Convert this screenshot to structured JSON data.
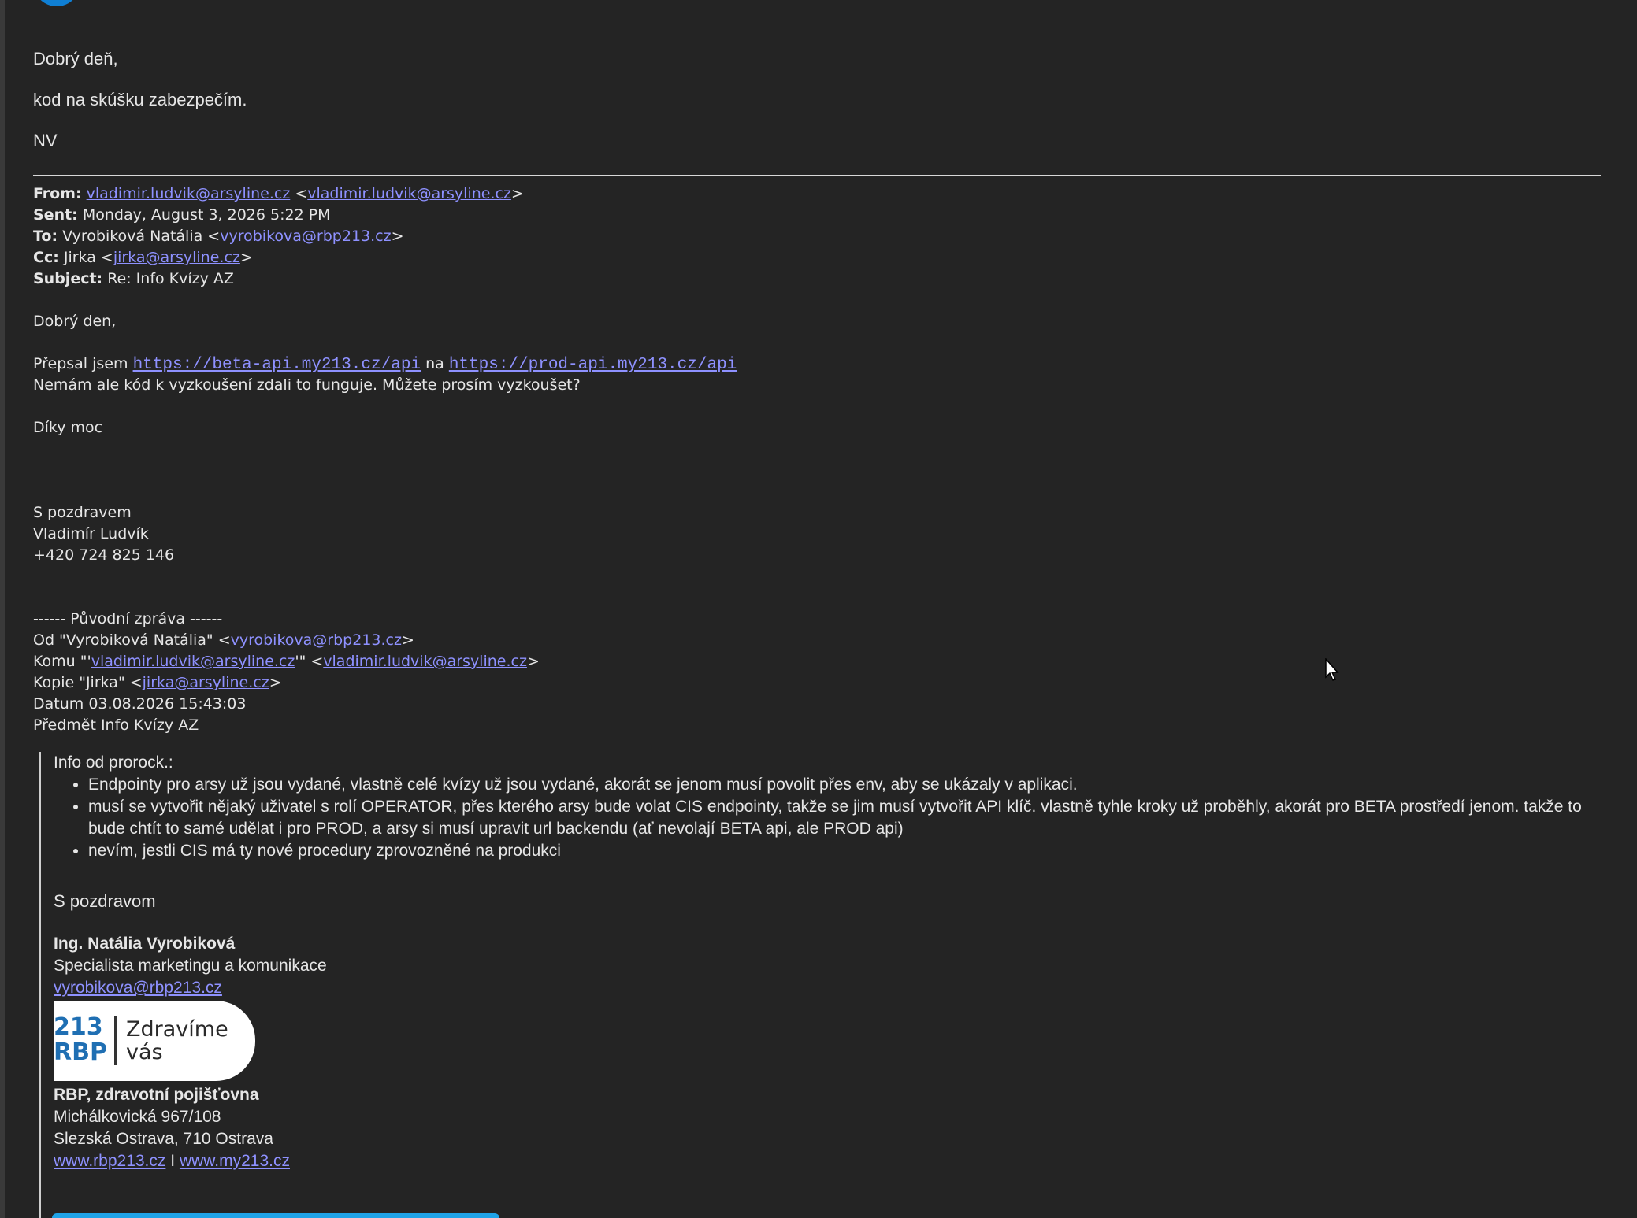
{
  "reply": {
    "greeting": "Dobrý deň,",
    "line1": "kod na skúšku zabezpečím.",
    "initials": "NV"
  },
  "quoted_header": {
    "from_label": "From:",
    "from_name_link": "vladimir.ludvik@arsyline.cz",
    "from_email_link": "vladimir.ludvik@arsyline.cz",
    "sent_label": "Sent:",
    "sent_value": "Monday, August 3, 2026 5:22 PM",
    "to_label": "To:",
    "to_name": "Vyrobiková Natália",
    "to_email": "vyrobikova@rbp213.cz",
    "cc_label": "Cc:",
    "cc_name": "Jirka",
    "cc_email": "jirka@arsyline.cz",
    "subject_label": "Subject:",
    "subject_value": "Re: Info Kvízy AZ"
  },
  "quoted_body": {
    "greeting": "Dobrý den,",
    "rewrote_prefix": "Přepsal jsem",
    "beta_url": "https://beta-api.my213.cz/api",
    "rewrote_mid": "na",
    "prod_url": "https://prod-api.my213.cz/api",
    "line2": "Nemám ale kód k vyzkoušení zdali to funguje. Můžete prosím vyzkoušet?",
    "thanks": "Díky moc",
    "regards": "S pozdravem",
    "name": "Vladimír Ludvík",
    "phone": "+420 724 825 146"
  },
  "original_header": {
    "separator": "------ Původní zpráva ------",
    "od_prefix": "Od \"Vyrobiková Natália\" <",
    "od_email": "vyrobikova@rbp213.cz",
    "komu_prefix": "Komu \"'",
    "komu_email1": "vladimir.ludvik@arsyline.cz",
    "komu_mid": "'\" <",
    "komu_email2": "vladimir.ludvik@arsyline.cz",
    "kopie_prefix": "Kopie \"Jirka\" <",
    "kopie_email": "jirka@arsyline.cz",
    "datum": "Datum 03.08.2026 15:43:03",
    "predmet": "Předmět Info Kvízy AZ"
  },
  "original_body": {
    "intro": "Info od prorock.:",
    "bullets": [
      "Endpointy pro arsy už jsou vydané, vlastně celé kvízy už jsou vydané, akorát se jenom musí povolit přes env, aby se ukázaly v aplikaci.",
      "musí se vytvořit nějaký uživatel s rolí OPERATOR, přes kterého arsy bude volat CIS endpointy, takže se jim musí vytvořit API klíč. vlastně tyhle kroky už proběhly, akorát pro BETA prostředí jenom. takže to bude chtít to samé udělat i pro PROD, a arsy si musí upravit url backendu (ať nevolají BETA api, ale PROD api)",
      "nevím, jestli CIS má ty nové procedury zprovozněné na produkci"
    ],
    "regards": "S pozdravom",
    "sig_name": "Ing. Natália Vyrobiková",
    "sig_title": "Specialista marketingu a komunikace",
    "sig_email": "vyrobikova@rbp213.cz",
    "logo_mark": "213 RBP",
    "logo_tagline": "Zdravíme vás",
    "company": "RBP, zdravotní pojišťovna",
    "address1": "Michálkovická 967/108",
    "address2": "Slezská Ostrava, 710 Ostrava",
    "web1": "www.rbp213.cz",
    "web_sep": "I",
    "web2": "www.my213.cz"
  },
  "colors": {
    "background": "#242424",
    "text": "#e6e6e6",
    "link": "#8e91ff",
    "avatar": "#0f7fd4",
    "banner": "#1fa3e8"
  }
}
